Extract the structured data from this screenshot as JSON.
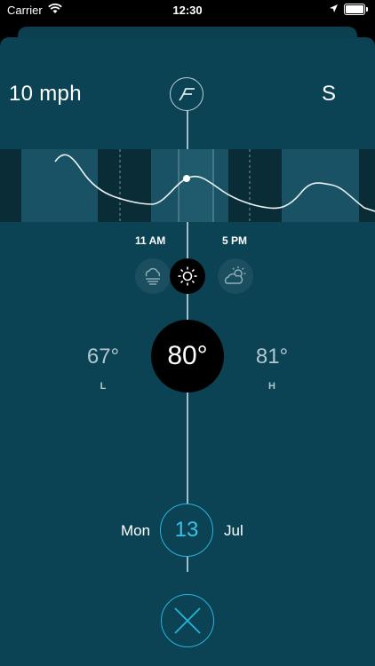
{
  "status_bar": {
    "carrier": "Carrier",
    "time": "12:30"
  },
  "wind": {
    "speed": "10 mph",
    "direction": "S"
  },
  "timeline": {
    "start_label": "11 AM",
    "end_label": "5 PM"
  },
  "conditions": {
    "left_icon": "fog-icon",
    "center_icon": "sun-icon",
    "right_icon": "partly-cloudy-icon"
  },
  "temperature": {
    "current": "80°",
    "low": "67°",
    "low_label": "L",
    "high": "81°",
    "high_label": "H"
  },
  "date": {
    "day": "Mon",
    "date": "13",
    "month": "Jul"
  },
  "colors": {
    "background": "#0b4354",
    "accent": "#27b3d9",
    "line": "#9fc0cb"
  }
}
